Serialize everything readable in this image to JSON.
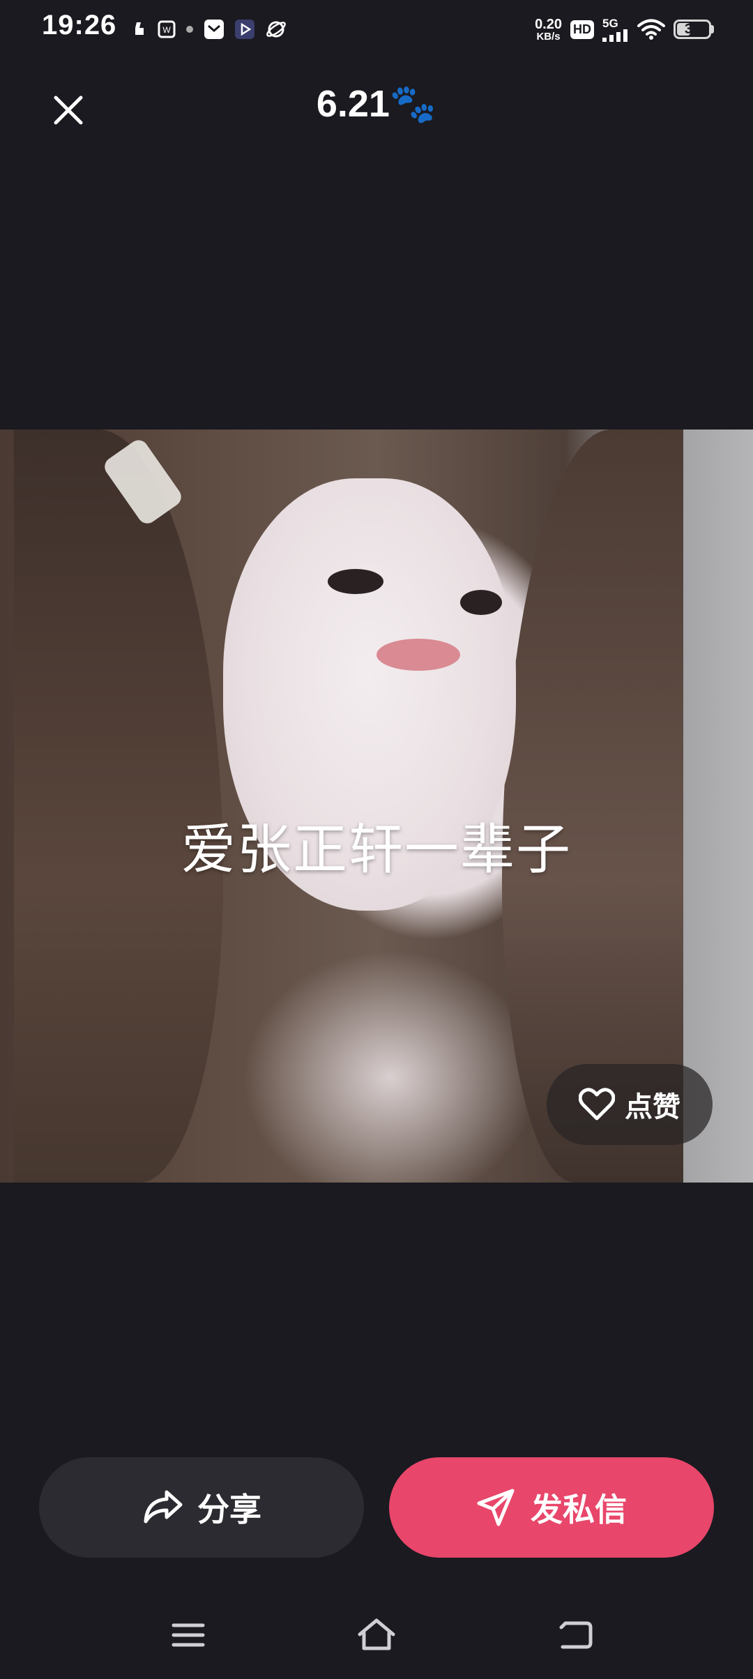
{
  "status_bar": {
    "time": "19:26",
    "net_speed_value": "0.20",
    "net_speed_unit": "KB/s",
    "hd_label": "HD",
    "network_label": "5G",
    "battery_level": "39"
  },
  "header": {
    "title": "6.21🐾"
  },
  "photo": {
    "caption": "爱张正轩一辈子",
    "like_label": "点赞"
  },
  "actions": {
    "share_label": "分享",
    "dm_label": "发私信"
  },
  "colors": {
    "background": "#1a1a20",
    "share_button": "#2b2b31",
    "dm_button": "#e8466a"
  }
}
